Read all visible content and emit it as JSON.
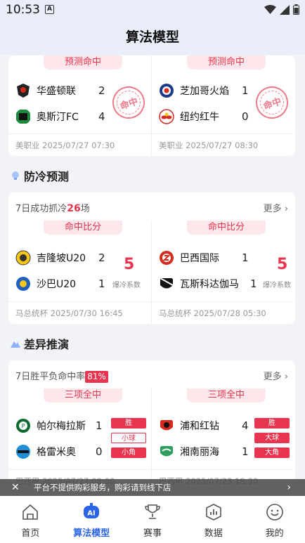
{
  "status": {
    "time": "10:53",
    "a_icon": "A"
  },
  "header": {
    "title": "算法模型"
  },
  "hit_card": {
    "left": {
      "tag": "预测命中",
      "home": "华盛顿联",
      "home_score": "2",
      "away": "奥斯汀FC",
      "away_score": "4",
      "seal": "命中",
      "league": "美职业",
      "time": "2025/07/27 07:30"
    },
    "right": {
      "tag": "预测命中",
      "home": "芝加哥火焰",
      "home_score": "1",
      "away": "纽约红牛",
      "away_score": "0",
      "seal": "命中",
      "league": "美职业",
      "time": "2025/07/27 08:30"
    }
  },
  "cold": {
    "title": "防冷预测",
    "summary_prefix": "7日成功抓冷",
    "summary_num": "26",
    "summary_suffix": "场",
    "more": "更多",
    "left": {
      "tag": "命中比分",
      "home": "吉隆坡U20",
      "home_score": "2",
      "away": "沙巴U20",
      "away_score": "1",
      "index": "5",
      "index_label": "爆冷系数",
      "league": "马总统杯",
      "time": "2025/07/30 16:45"
    },
    "right": {
      "tag": "命中比分",
      "home": "巴西国际",
      "home_score": "1",
      "away": "瓦斯科达伽马",
      "away_score": "1",
      "index": "5",
      "index_label": "爆冷系数",
      "league": "马总统杯",
      "time": "2025/07/28 05:30"
    }
  },
  "diff": {
    "title": "差异推演",
    "summary_prefix": "7日胜平负命中率",
    "summary_badge": "81%",
    "more": "更多",
    "left": {
      "tag": "三项全中",
      "home": "帕尔梅拉斯",
      "home_score": "1",
      "away": "格雷米奥",
      "away_score": "0",
      "pills": [
        "胜",
        "小球",
        "小角"
      ],
      "league": "巴西甲",
      "time": "2025/07/27 08:00"
    },
    "right": {
      "tag": "三项全中",
      "home": "浦和红钻",
      "home_score": "4",
      "away": "湘南丽海",
      "away_score": "1",
      "pills": [
        "胜",
        "大球",
        "大角"
      ],
      "league": "巴西甲",
      "time": "2025/07/23 18:30"
    }
  },
  "banner": {
    "text": "平台不提供购彩服务，购彩请到线下店"
  },
  "tabs": [
    {
      "label": "首页",
      "icon": "home-icon"
    },
    {
      "label": "算法模型",
      "icon": "ai-icon"
    },
    {
      "label": "赛事",
      "icon": "trophy-icon"
    },
    {
      "label": "数据",
      "icon": "chart-icon"
    },
    {
      "label": "我的",
      "icon": "smile-icon"
    }
  ],
  "colors": {
    "accent": "#e8344e",
    "tab_active": "#2c64e8",
    "bg": "#f2f3f7"
  }
}
